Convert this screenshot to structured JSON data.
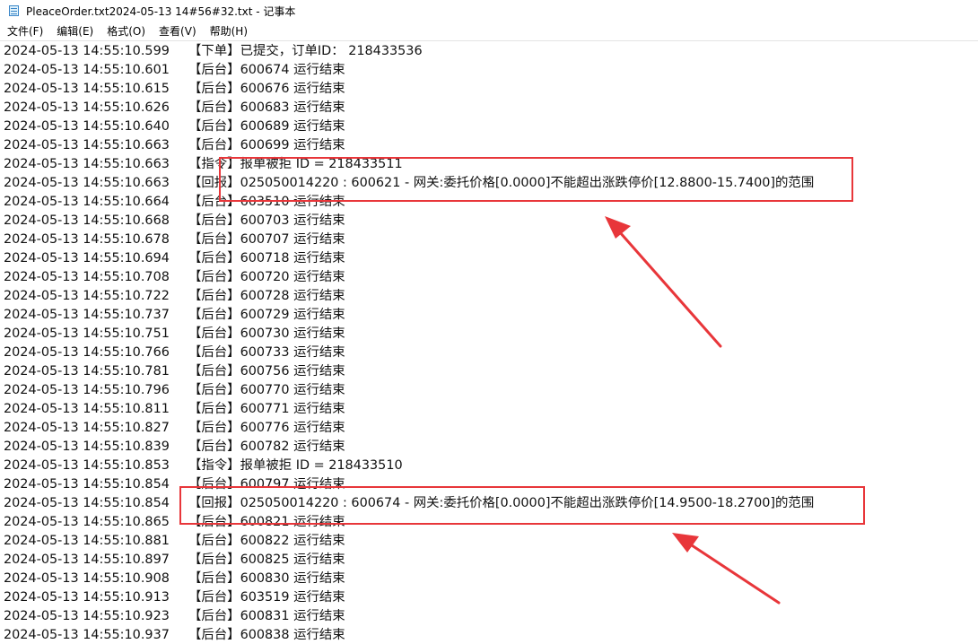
{
  "window": {
    "title": "PleaceOrder.txt2024-05-13 14#56#32.txt - 记事本"
  },
  "menu": [
    {
      "label": "文件(F)"
    },
    {
      "label": "编辑(E)"
    },
    {
      "label": "格式(O)"
    },
    {
      "label": "查看(V)"
    },
    {
      "label": "帮助(H)"
    }
  ],
  "lines": [
    {
      "ts": "2024-05-13 14:55:10.599",
      "msg": "【下单】已提交，订单ID： 218433536"
    },
    {
      "ts": "2024-05-13 14:55:10.601",
      "msg": "【后台】600674 运行结束"
    },
    {
      "ts": "2024-05-13 14:55:10.615",
      "msg": "【后台】600676 运行结束"
    },
    {
      "ts": "2024-05-13 14:55:10.626",
      "msg": "【后台】600683 运行结束"
    },
    {
      "ts": "2024-05-13 14:55:10.640",
      "msg": "【后台】600689 运行结束"
    },
    {
      "ts": "2024-05-13 14:55:10.663",
      "msg": "【后台】600699 运行结束"
    },
    {
      "ts": "2024-05-13 14:55:10.663",
      "msg": "【指令】报单被拒 ID = 218433511"
    },
    {
      "ts": "2024-05-13 14:55:10.663",
      "msg": "【回报】025050014220 : 600621 - 网关:委托价格[0.0000]不能超出涨跌停价[12.8800-15.7400]的范围"
    },
    {
      "ts": "2024-05-13 14:55:10.664",
      "msg": "【后台】603510 运行结束"
    },
    {
      "ts": "2024-05-13 14:55:10.668",
      "msg": "【后台】600703 运行结束"
    },
    {
      "ts": "2024-05-13 14:55:10.678",
      "msg": "【后台】600707 运行结束"
    },
    {
      "ts": "2024-05-13 14:55:10.694",
      "msg": "【后台】600718 运行结束"
    },
    {
      "ts": "2024-05-13 14:55:10.708",
      "msg": "【后台】600720 运行结束"
    },
    {
      "ts": "2024-05-13 14:55:10.722",
      "msg": "【后台】600728 运行结束"
    },
    {
      "ts": "2024-05-13 14:55:10.737",
      "msg": "【后台】600729 运行结束"
    },
    {
      "ts": "2024-05-13 14:55:10.751",
      "msg": "【后台】600730 运行结束"
    },
    {
      "ts": "2024-05-13 14:55:10.766",
      "msg": "【后台】600733 运行结束"
    },
    {
      "ts": "2024-05-13 14:55:10.781",
      "msg": "【后台】600756 运行结束"
    },
    {
      "ts": "2024-05-13 14:55:10.796",
      "msg": "【后台】600770 运行结束"
    },
    {
      "ts": "2024-05-13 14:55:10.811",
      "msg": "【后台】600771 运行结束"
    },
    {
      "ts": "2024-05-13 14:55:10.827",
      "msg": "【后台】600776 运行结束"
    },
    {
      "ts": "2024-05-13 14:55:10.839",
      "msg": "【后台】600782 运行结束"
    },
    {
      "ts": "2024-05-13 14:55:10.853",
      "msg": "【指令】报单被拒 ID = 218433510"
    },
    {
      "ts": "2024-05-13 14:55:10.854",
      "msg": "【后台】600797 运行结束"
    },
    {
      "ts": "2024-05-13 14:55:10.854",
      "msg": "【回报】025050014220 : 600674 - 网关:委托价格[0.0000]不能超出涨跌停价[14.9500-18.2700]的范围"
    },
    {
      "ts": "2024-05-13 14:55:10.865",
      "msg": "【后台】600821 运行结束"
    },
    {
      "ts": "2024-05-13 14:55:10.881",
      "msg": "【后台】600822 运行结束"
    },
    {
      "ts": "2024-05-13 14:55:10.897",
      "msg": "【后台】600825 运行结束"
    },
    {
      "ts": "2024-05-13 14:55:10.908",
      "msg": "【后台】600830 运行结束"
    },
    {
      "ts": "2024-05-13 14:55:10.913",
      "msg": "【后台】603519 运行结束"
    },
    {
      "ts": "2024-05-13 14:55:10.923",
      "msg": "【后台】600831 运行结束"
    },
    {
      "ts": "2024-05-13 14:55:10.937",
      "msg": "【后台】600838 运行结束"
    }
  ],
  "annotation": {
    "color": "#e8363a"
  }
}
